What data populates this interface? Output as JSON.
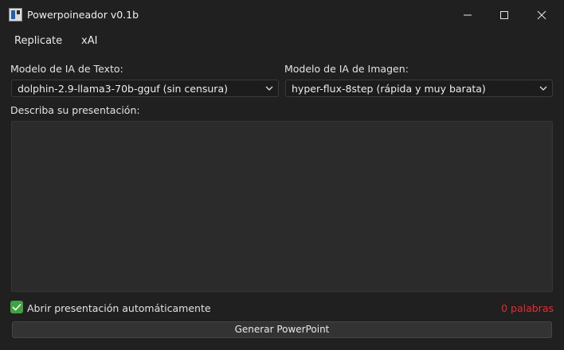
{
  "window": {
    "title": "Powerpoineador v0.1b",
    "icons": {
      "app": "app-icon",
      "minimize": "minimize-icon",
      "maximize": "maximize-icon",
      "close": "close-icon"
    }
  },
  "menu": {
    "items": [
      "Replicate",
      "xAI"
    ]
  },
  "text_model": {
    "label": "Modelo de IA de Texto:",
    "selected": "dolphin-2.9-llama3-70b-gguf (sin censura)"
  },
  "image_model": {
    "label": "Modelo de IA de Imagen:",
    "selected": "hyper-flux-8step (rápida y muy barata)"
  },
  "description": {
    "label": "Describa su presentación:",
    "value": ""
  },
  "auto_open": {
    "label": "Abrir presentación automáticamente",
    "checked": true
  },
  "word_count": {
    "text": "0 palabras",
    "color": "#e8292f"
  },
  "generate_button": {
    "label": "Generar PowerPoint"
  },
  "colors": {
    "background": "#202020",
    "accent_check": "#3ea33e"
  }
}
